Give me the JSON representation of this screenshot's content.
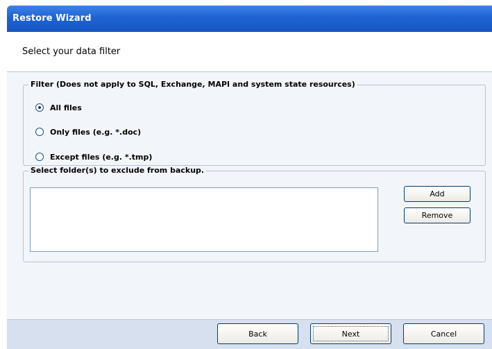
{
  "window": {
    "title": "Restore Wizard"
  },
  "header": {
    "heading": "Select your data filter"
  },
  "filter_group": {
    "legend": "Filter (Does not apply to SQL, Exchange, MAPI and system state resources)",
    "options": [
      {
        "label": "All files",
        "checked": true
      },
      {
        "label": "Only files (e.g. *.doc)",
        "checked": false
      },
      {
        "label": "Except files (e.g. *.tmp)",
        "checked": false
      }
    ]
  },
  "exclude_group": {
    "legend": "Select folder(s) to exclude from backup.",
    "folders": [],
    "add_label": "Add",
    "remove_label": "Remove"
  },
  "footer": {
    "back_label": "Back",
    "next_label": "Next",
    "cancel_label": "Cancel"
  },
  "colors": {
    "titlebar": "#1f63d3",
    "body": "#f2f5fa",
    "footer": "#d6e0ee",
    "group_border": "#b7c3d6"
  }
}
